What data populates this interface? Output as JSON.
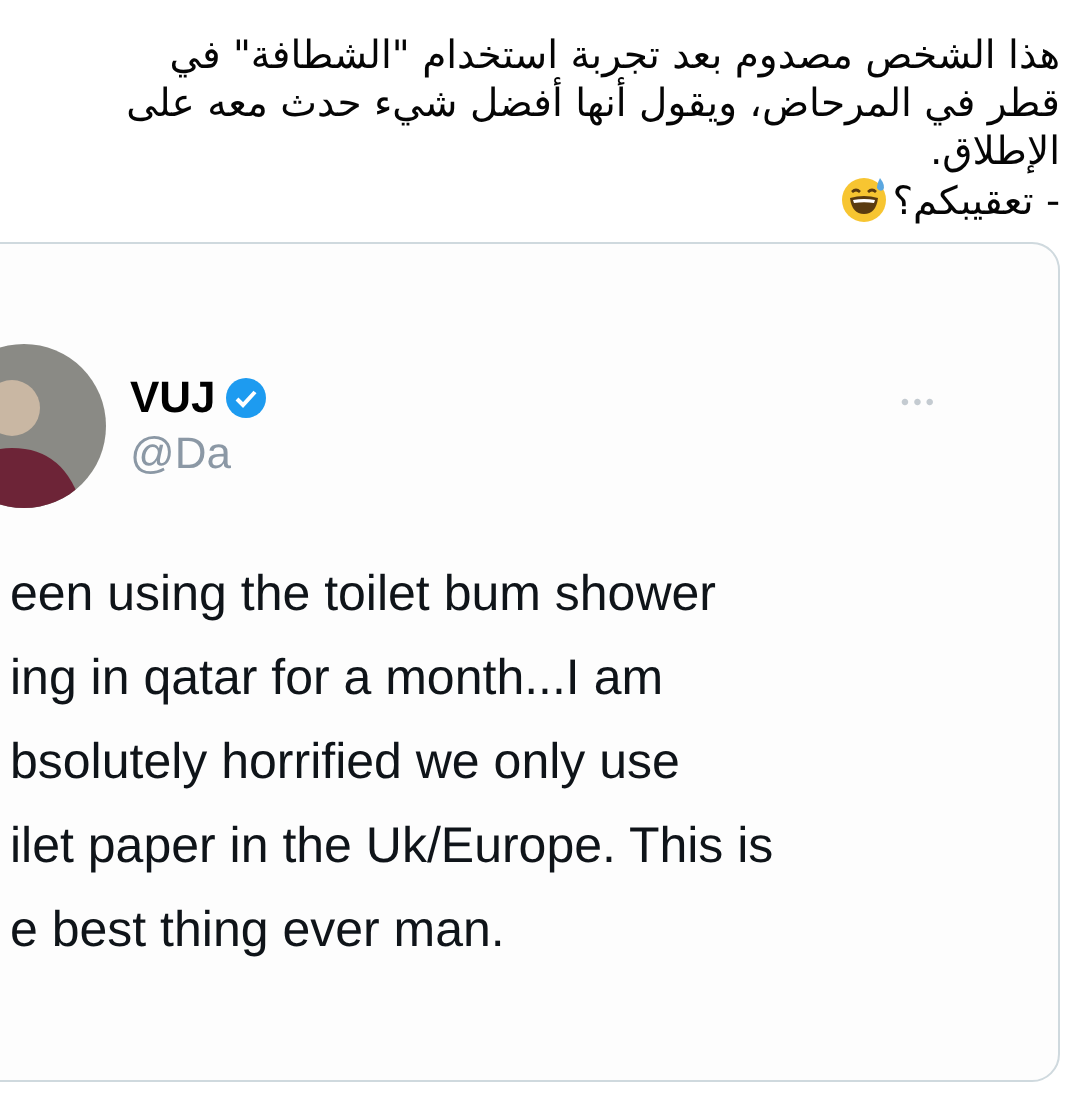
{
  "post": {
    "lines": [
      "هذا الشخص مصدوم بعد تجربة استخدام \"الشطافة\" في",
      "قطر في المرحاض، ويقول أنها أفضل شيء حدث معه على",
      "الإطلاق."
    ],
    "question": "- تعقيبكم؟"
  },
  "tweet": {
    "name": "VUJ",
    "verified": true,
    "handle": "@Da",
    "more": "•••",
    "lines": [
      "een using the toilet bum shower",
      "ing in qatar for a month...I am",
      "bsolutely horrified we only use",
      "ilet paper in the Uk/Europe. This is",
      "e best thing ever man."
    ]
  }
}
